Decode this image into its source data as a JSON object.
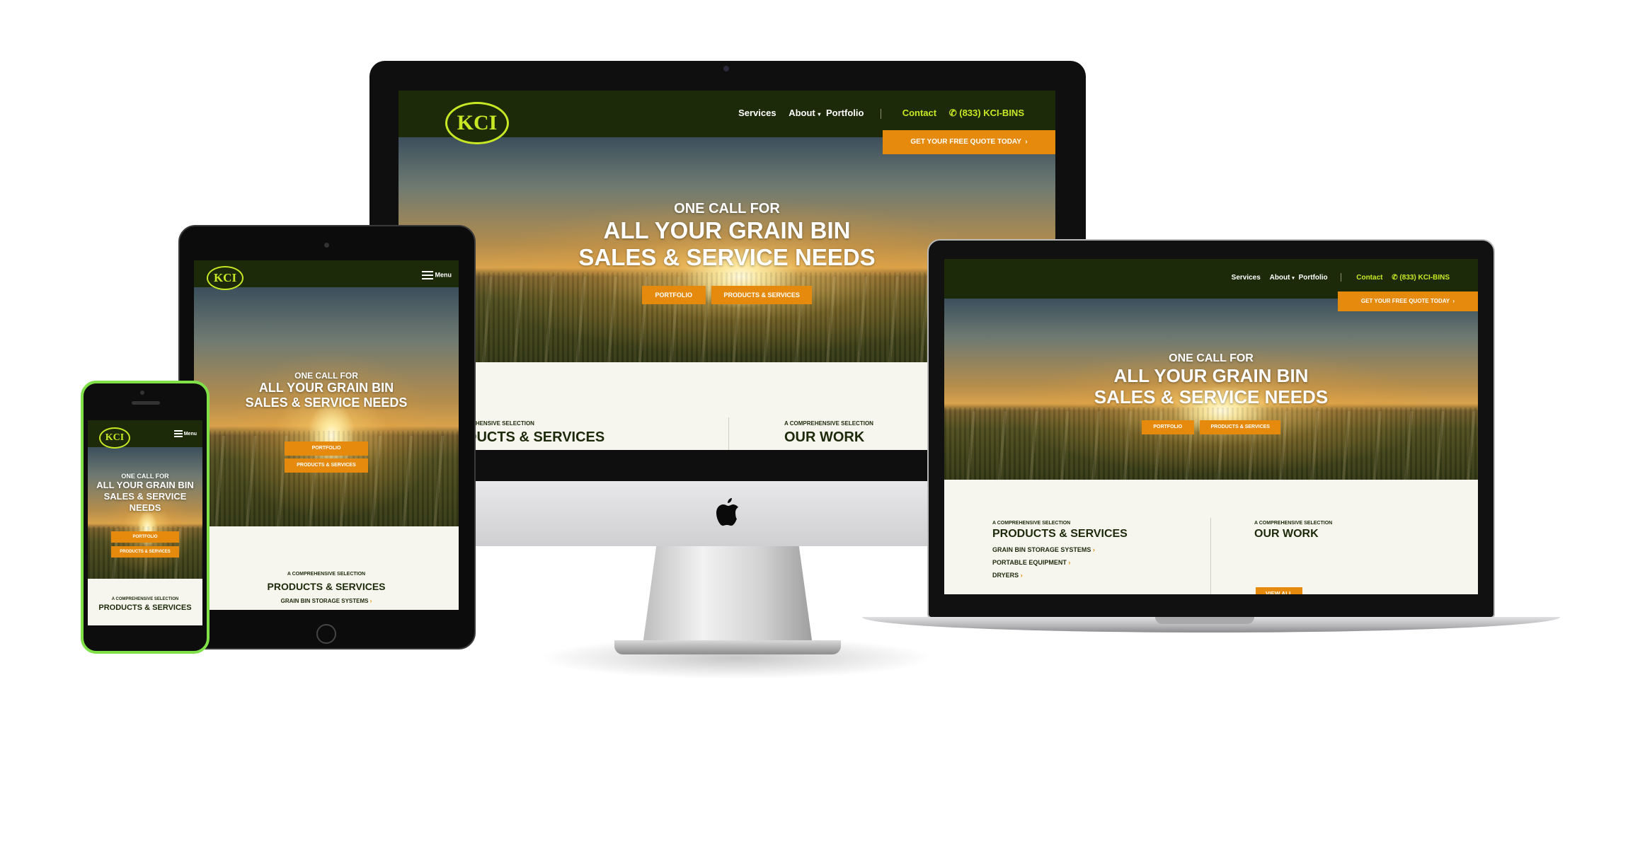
{
  "brand": {
    "logo_text": "KCI",
    "accent": "#e58a0c",
    "lime": "#c8e825",
    "dark": "#1d2a0a"
  },
  "nav": {
    "services": "Services",
    "about": "About",
    "portfolio": "Portfolio",
    "contact": "Contact",
    "phone": "(833) KCI-BINS",
    "quote_button": "GET YOUR FREE QUOTE TODAY",
    "menu_label": "Menu"
  },
  "hero": {
    "line1": "ONE CALL FOR",
    "line2": "ALL YOUR GRAIN BIN",
    "line3": "SALES & SERVICE NEEDS",
    "line2_mobile": "ALL YOUR GRAIN BIN SALES & SERVICE NEEDS",
    "portfolio_button": "PORTFOLIO",
    "products_button": "PRODUCTS & SERVICES"
  },
  "sections": {
    "kicker": "A COMPREHENSIVE SELECTION",
    "products_heading": "PRODUCTS & SERVICES",
    "products_heading_imac": "RODUCTS & SERVICES",
    "products_heading_laptop": "PRODUCTS & SERVICES",
    "work_heading": "OUR WORK",
    "list": [
      "GRAIN BIN STORAGE SYSTEMS",
      "PORTABLE EQUIPMENT",
      "DRYERS"
    ],
    "view_all": "VIEW ALL"
  },
  "icons": {
    "phone": "phone-icon",
    "chevron": "chevron-right-icon",
    "caret": "caret-down-icon",
    "apple": "apple-logo-icon",
    "menu": "hamburger-icon"
  }
}
